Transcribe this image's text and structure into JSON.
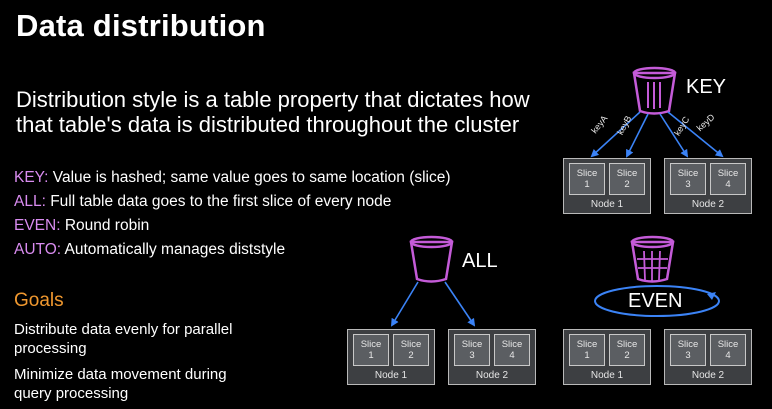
{
  "title": "Data distribution",
  "lead": "Distribution style is a table property that dictates how that table's data is distributed throughout the cluster",
  "styles": [
    {
      "key": "KEY:",
      "desc": "Value is hashed; same value goes to same location (slice)"
    },
    {
      "key": "ALL:",
      "desc": "Full table data goes to the first slice of every node"
    },
    {
      "key": "EVEN:",
      "desc": "Round robin"
    },
    {
      "key": "AUTO:",
      "desc": "Automatically manages diststyle"
    }
  ],
  "goals": {
    "heading": "Goals",
    "items": [
      "Distribute data evenly for parallel processing",
      "Minimize data movement during query processing"
    ]
  },
  "diagrams": {
    "key": {
      "label": "KEY",
      "keys": [
        "keyA",
        "keyB",
        "keyC",
        "keyD"
      ],
      "nodes": [
        {
          "name": "Node 1",
          "slices": [
            {
              "name": "Slice",
              "num": "1"
            },
            {
              "name": "Slice",
              "num": "2"
            }
          ]
        },
        {
          "name": "Node 2",
          "slices": [
            {
              "name": "Slice",
              "num": "3"
            },
            {
              "name": "Slice",
              "num": "4"
            }
          ]
        }
      ]
    },
    "all": {
      "label": "ALL",
      "nodes": [
        {
          "name": "Node 1",
          "slices": [
            {
              "name": "Slice",
              "num": "1"
            },
            {
              "name": "Slice",
              "num": "2"
            }
          ]
        },
        {
          "name": "Node 2",
          "slices": [
            {
              "name": "Slice",
              "num": "3"
            },
            {
              "name": "Slice",
              "num": "4"
            }
          ]
        }
      ]
    },
    "even": {
      "label": "EVEN",
      "nodes": [
        {
          "name": "Node 1",
          "slices": [
            {
              "name": "Slice",
              "num": "1"
            },
            {
              "name": "Slice",
              "num": "2"
            }
          ]
        },
        {
          "name": "Node 2",
          "slices": [
            {
              "name": "Slice",
              "num": "3"
            },
            {
              "name": "Slice",
              "num": "4"
            }
          ]
        }
      ]
    }
  },
  "colors": {
    "accent_key": "#d98cf0",
    "goals": "#f0982f",
    "arrow": "#3b83f6",
    "bucket": "#c45bd8"
  }
}
